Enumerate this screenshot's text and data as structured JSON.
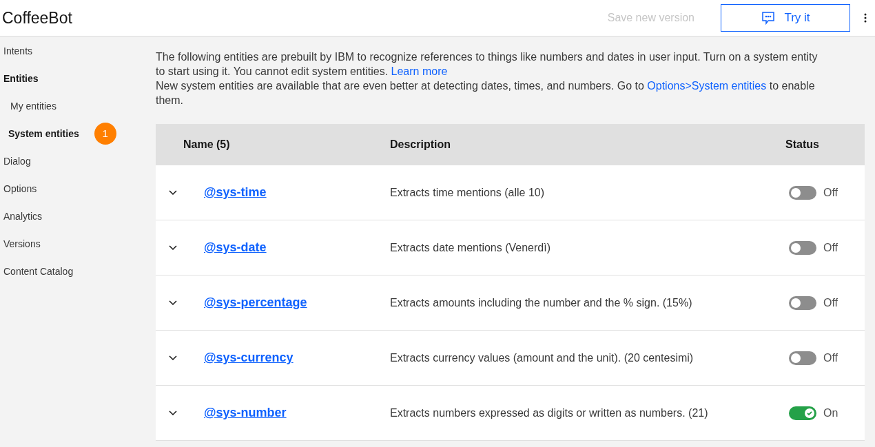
{
  "header": {
    "title": "CoffeeBot",
    "save_button": {
      "label": "Save new version",
      "disabled": true
    },
    "try_button": {
      "label": "Try it"
    }
  },
  "sidebar": {
    "items": [
      {
        "label": "Intents",
        "selected": false
      },
      {
        "label": "Entities",
        "expanded": true,
        "children": [
          {
            "label": "My entities",
            "selected": false
          },
          {
            "label": "System entities",
            "selected": true,
            "badge": "1"
          }
        ]
      },
      {
        "label": "Dialog",
        "selected": false
      },
      {
        "label": "Options",
        "selected": false
      },
      {
        "label": "Analytics",
        "selected": false
      },
      {
        "label": "Versions",
        "selected": false
      },
      {
        "label": "Content Catalog",
        "selected": false
      }
    ]
  },
  "intro": [
    {
      "text": "The following entities are prebuilt by IBM to recognize references to things like numbers and dates in user input. Turn on a system entity to start using it. You cannot edit system entities.",
      "link": "Learn more"
    },
    {
      "text": "New system entities are available that are even better at detecting dates, times, and numbers. Go to",
      "link": "Options>System entities",
      "after": "to enable them."
    }
  ],
  "table": {
    "columns": [
      "Name (5)",
      "Description",
      "Status"
    ],
    "rows": [
      {
        "name": "@sys-time",
        "description": "Extracts time mentions (alle 10)",
        "on": false,
        "status": "Off"
      },
      {
        "name": "@sys-date",
        "description": "Extracts date mentions (Venerdì)",
        "on": false,
        "status": "Off"
      },
      {
        "name": "@sys-percentage",
        "description": "Extracts amounts including the number and the % sign. (15%)",
        "on": false,
        "status": "Off"
      },
      {
        "name": "@sys-currency",
        "description": "Extracts currency values (amount and the unit). (20 centesimi)",
        "on": false,
        "status": "Off"
      },
      {
        "name": "@sys-number",
        "description": "Extracts numbers expressed as digits or written as numbers. (21)",
        "on": true,
        "status": "On"
      }
    ]
  }
}
